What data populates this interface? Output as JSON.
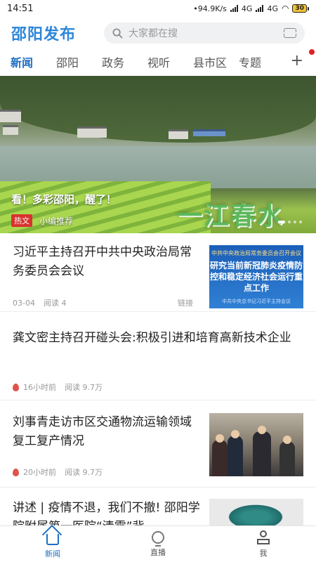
{
  "status_bar": {
    "time": "14:51",
    "speed": "•94.9K/s",
    "net1": "4G",
    "net2": "4G",
    "battery": "30"
  },
  "header": {
    "logo": "邵阳发布",
    "search_placeholder": "大家都在搜",
    "icons": [
      "search-icon",
      "scan-icon"
    ]
  },
  "tabs": [
    "新闻",
    "邵阳",
    "政务",
    "视听",
    "县市区",
    "专题"
  ],
  "tabs_more": "+",
  "hero": {
    "caption": "看！多彩邵阳，醒了！",
    "overlay_text": "一江春水",
    "tag": "热文",
    "recommend": "小编推荐"
  },
  "news": [
    {
      "title": "习近平主持召开中共中央政治局常务委员会会议",
      "date": "03-04",
      "reads": "阅读 4",
      "tag": "链接",
      "thumb": {
        "top": "中共中央政治局常务委员会召开会议",
        "main": "研究当前新冠肺炎疫情防控和稳定经济社会运行重点工作",
        "bottom": "中共中央总书记习近平主持会议"
      }
    },
    {
      "title": "龚文密主持召开碰头会:积极引进和培育高新技术企业",
      "time": "16小时前",
      "reads": "阅读 9.7万"
    },
    {
      "title": "刘事青走访市区交通物流运输领域复工复产情况",
      "time": "20小时前",
      "reads": "阅读 9.7万"
    },
    {
      "title": "讲述 | 疫情不退，我们不撤! 邵阳学院附属第一医院“清零”背"
    }
  ],
  "bottom_nav": [
    {
      "label": "新闻",
      "icon": "home-icon",
      "active": true
    },
    {
      "label": "直播",
      "icon": "live-icon",
      "active": false
    },
    {
      "label": "我",
      "icon": "user-icon",
      "active": false
    }
  ],
  "colors": {
    "brand": "#2d86d9",
    "active_tab": "#1e6fc2",
    "hot_badge": "#d9322f"
  }
}
